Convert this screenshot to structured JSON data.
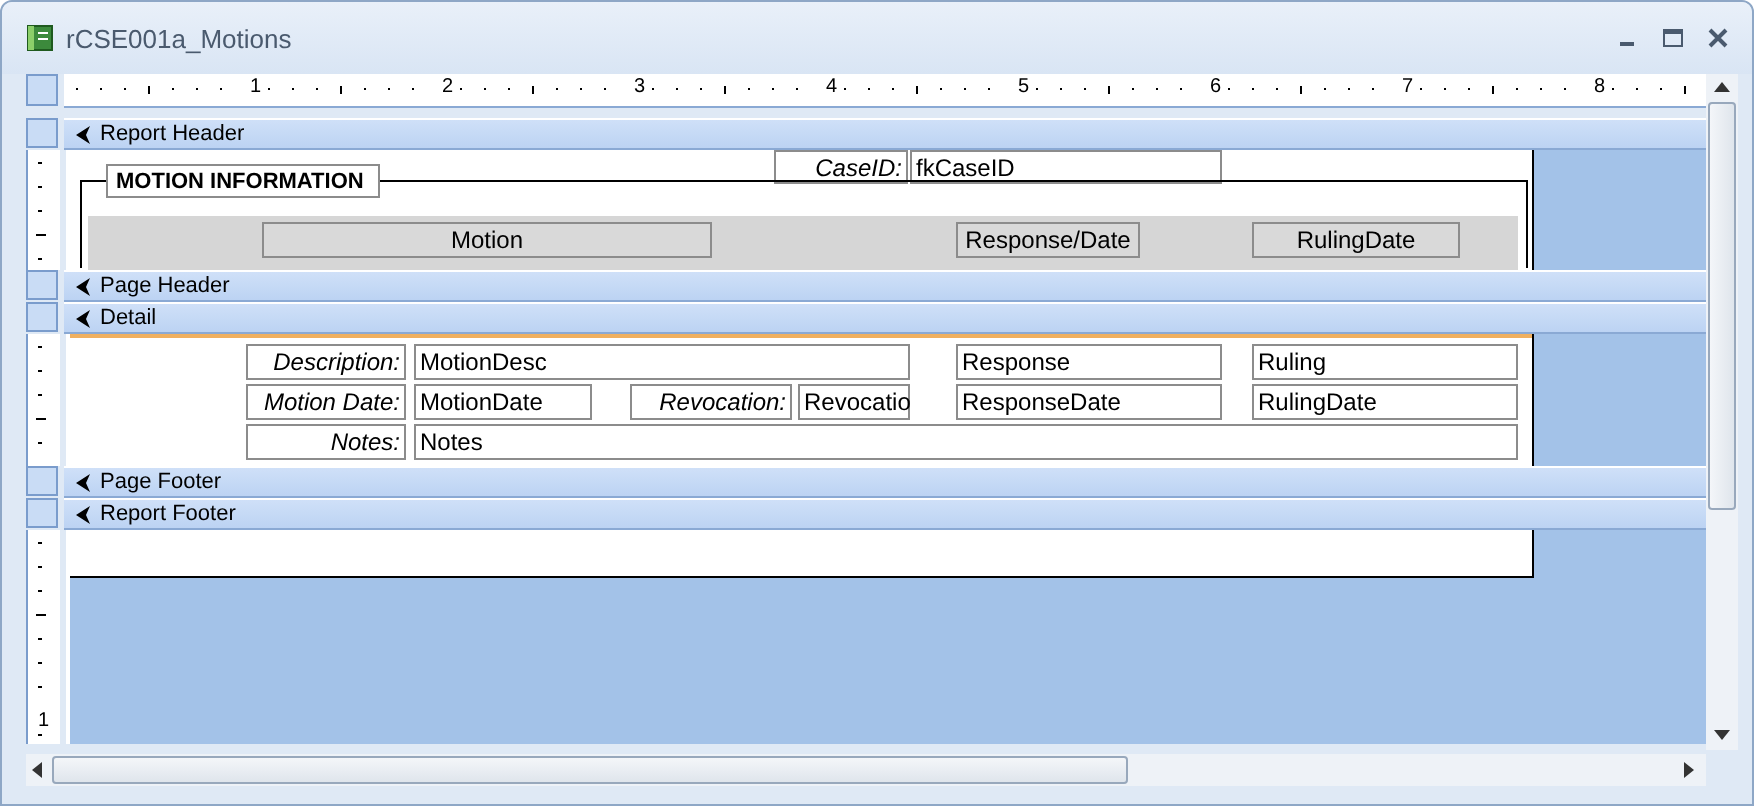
{
  "window": {
    "title": "rCSE001a_Motions"
  },
  "ruler": {
    "marks": [
      "1",
      "2",
      "3",
      "4",
      "5",
      "6",
      "7",
      "8"
    ]
  },
  "vertical_ruler": {
    "marks": [
      "1"
    ]
  },
  "sections": [
    {
      "name": "Report Header",
      "controls": [
        {
          "kind": "label",
          "text": "CaseID:"
        },
        {
          "kind": "textbox",
          "text": "fkCaseID"
        },
        {
          "kind": "frame",
          "text": "MOTION INFORMATION"
        },
        {
          "kind": "header",
          "text": "Motion"
        },
        {
          "kind": "header",
          "text": "Response/Date"
        },
        {
          "kind": "header",
          "text": "RulingDate"
        }
      ]
    },
    {
      "name": "Page Header"
    },
    {
      "name": "Detail",
      "controls": [
        {
          "kind": "label",
          "text": "Description:"
        },
        {
          "kind": "textbox",
          "text": "MotionDesc"
        },
        {
          "kind": "textbox",
          "text": "Response"
        },
        {
          "kind": "textbox",
          "text": "Ruling"
        },
        {
          "kind": "label",
          "text": "Motion Date:"
        },
        {
          "kind": "textbox",
          "text": "MotionDate"
        },
        {
          "kind": "label",
          "text": "Revocation:"
        },
        {
          "kind": "textbox",
          "text": "Revocatio"
        },
        {
          "kind": "textbox",
          "text": "ResponseDate"
        },
        {
          "kind": "textbox",
          "text": "RulingDate"
        },
        {
          "kind": "label",
          "text": "Notes:"
        },
        {
          "kind": "textbox",
          "text": "Notes"
        }
      ]
    },
    {
      "name": "Page Footer"
    },
    {
      "name": "Report Footer"
    }
  ]
}
